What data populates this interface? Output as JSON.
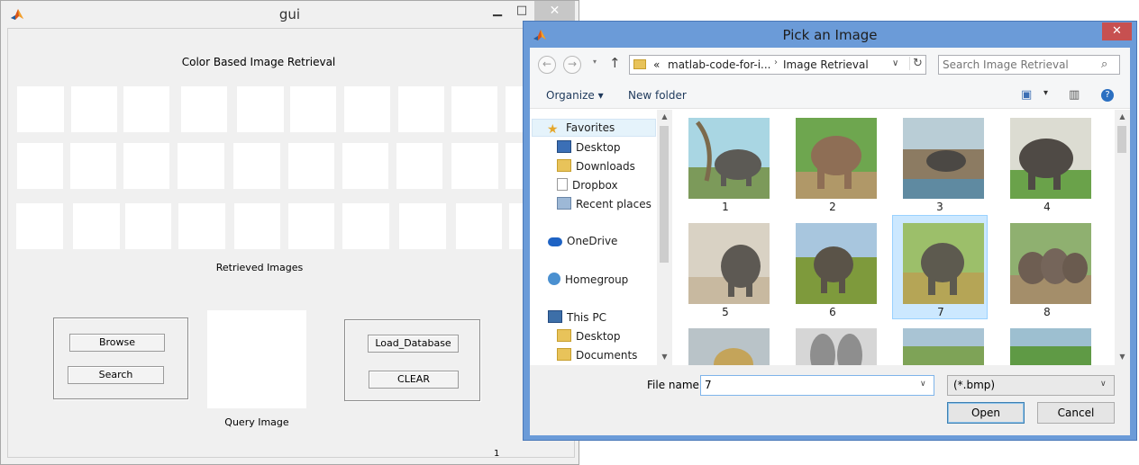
{
  "gui": {
    "title": "gui",
    "minimize_glyph": "▁",
    "maximize_glyph": "□",
    "close_glyph": "✕",
    "heading": "Color Based Image Retrieval",
    "retrieved_label": "Retrieved Images",
    "query_label": "Query Image",
    "buttons": {
      "browse": "Browse",
      "search": "Search",
      "load_database": "Load_Database",
      "clear": "CLEAR"
    },
    "stray_text": "1"
  },
  "dialog": {
    "title": "Pick an Image",
    "close_glyph": "✕",
    "nav": {
      "back_glyph": "←",
      "forward_glyph": "→",
      "recent_glyph": "▾",
      "up_glyph": "↑"
    },
    "address": {
      "overflow_glyph": "«",
      "segments": [
        "matlab-code-for-i...",
        "Image Retrieval"
      ],
      "separator_glyph": "›",
      "dropdown_glyph": "∨",
      "refresh_glyph": "↻"
    },
    "search_placeholder": "Search Image Retrieval",
    "search_glyph": "⌕",
    "toolbar": {
      "organize": "Organize ▾",
      "new_folder": "New folder",
      "view_glyph": "▣",
      "view_drop_glyph": "▾",
      "preview_glyph": "▥",
      "help_glyph": "?"
    },
    "nav_pane": [
      {
        "label": "Favorites",
        "icon": "star-icon"
      },
      {
        "label": "Desktop",
        "icon": "desktop-icon"
      },
      {
        "label": "Downloads",
        "icon": "downloads-icon"
      },
      {
        "label": "Dropbox",
        "icon": "document-icon"
      },
      {
        "label": "Recent places",
        "icon": "recent-places-icon"
      },
      {
        "label": "OneDrive",
        "icon": "cloud-icon"
      },
      {
        "label": "Homegroup",
        "icon": "homegroup-icon"
      },
      {
        "label": "This PC",
        "icon": "computer-icon"
      },
      {
        "label": "Desktop",
        "icon": "folder-icon"
      },
      {
        "label": "Documents",
        "icon": "folder-icon"
      }
    ],
    "files": [
      {
        "label": "1",
        "selected": false
      },
      {
        "label": "2",
        "selected": false
      },
      {
        "label": "3",
        "selected": false
      },
      {
        "label": "4",
        "selected": false
      },
      {
        "label": "5",
        "selected": false
      },
      {
        "label": "6",
        "selected": false
      },
      {
        "label": "7",
        "selected": true
      },
      {
        "label": "8",
        "selected": false
      },
      {
        "label": "",
        "selected": false
      },
      {
        "label": "",
        "selected": false
      },
      {
        "label": "",
        "selected": false
      },
      {
        "label": "",
        "selected": false
      }
    ],
    "file_name_label": "File name:",
    "file_name_value": "7",
    "file_type": "(*.bmp)",
    "dropdown_glyph": "∨",
    "open_label": "Open",
    "cancel_label": "Cancel",
    "scroll_up_glyph": "▲",
    "scroll_down_glyph": "▼"
  },
  "colors": {
    "dialog_frame": "#6b9bd8",
    "close_button": "#c75050",
    "selection": "#cce8ff"
  }
}
